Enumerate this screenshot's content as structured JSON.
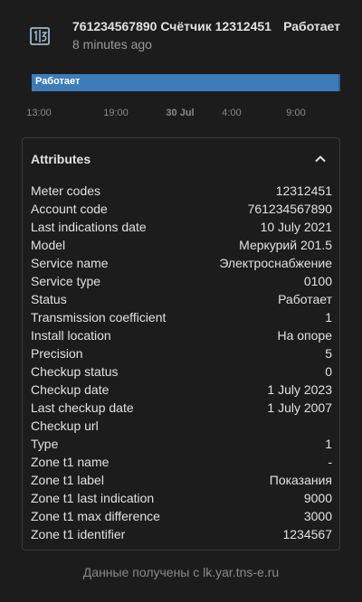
{
  "entity": {
    "name": "761234567890 Счётчик 12312451",
    "time": "8 minutes ago",
    "state": "Работает",
    "icon": "meter-icon"
  },
  "timeline": {
    "bar_label": "Работает",
    "state_color": "#3e7cb9",
    "ticks": [
      "13:00",
      "19:00",
      "30 Jul",
      "4:00",
      "9:00"
    ]
  },
  "attributes": {
    "title": "Attributes",
    "toggle_icon": "chevron-up-icon",
    "rows": [
      {
        "key": "Meter codes",
        "value": "12312451"
      },
      {
        "key": "Account code",
        "value": "761234567890"
      },
      {
        "key": "Last indications date",
        "value": "10 July 2021"
      },
      {
        "key": "Model",
        "value": "Меркурий 201.5"
      },
      {
        "key": "Service name",
        "value": "Электроснабжение"
      },
      {
        "key": "Service type",
        "value": "0100"
      },
      {
        "key": "Status",
        "value": "Работает"
      },
      {
        "key": "Transmission coefficient",
        "value": "1"
      },
      {
        "key": "Install location",
        "value": "На опоре"
      },
      {
        "key": "Precision",
        "value": "5"
      },
      {
        "key": "Checkup status",
        "value": "0"
      },
      {
        "key": "Checkup date",
        "value": "1 July 2023"
      },
      {
        "key": "Last checkup date",
        "value": "1 July 2007"
      },
      {
        "key": "Checkup url",
        "value": ""
      },
      {
        "key": "Type",
        "value": "1"
      },
      {
        "key": "Zone t1 name",
        "value": "-"
      },
      {
        "key": "Zone t1 label",
        "value": "Показания"
      },
      {
        "key": "Zone t1 last indication",
        "value": "9000"
      },
      {
        "key": "Zone t1 max difference",
        "value": "3000"
      },
      {
        "key": "Zone t1 identifier",
        "value": "1234567"
      }
    ]
  },
  "footer": {
    "text": "Данные получены с lk.yar.tns-e.ru"
  }
}
